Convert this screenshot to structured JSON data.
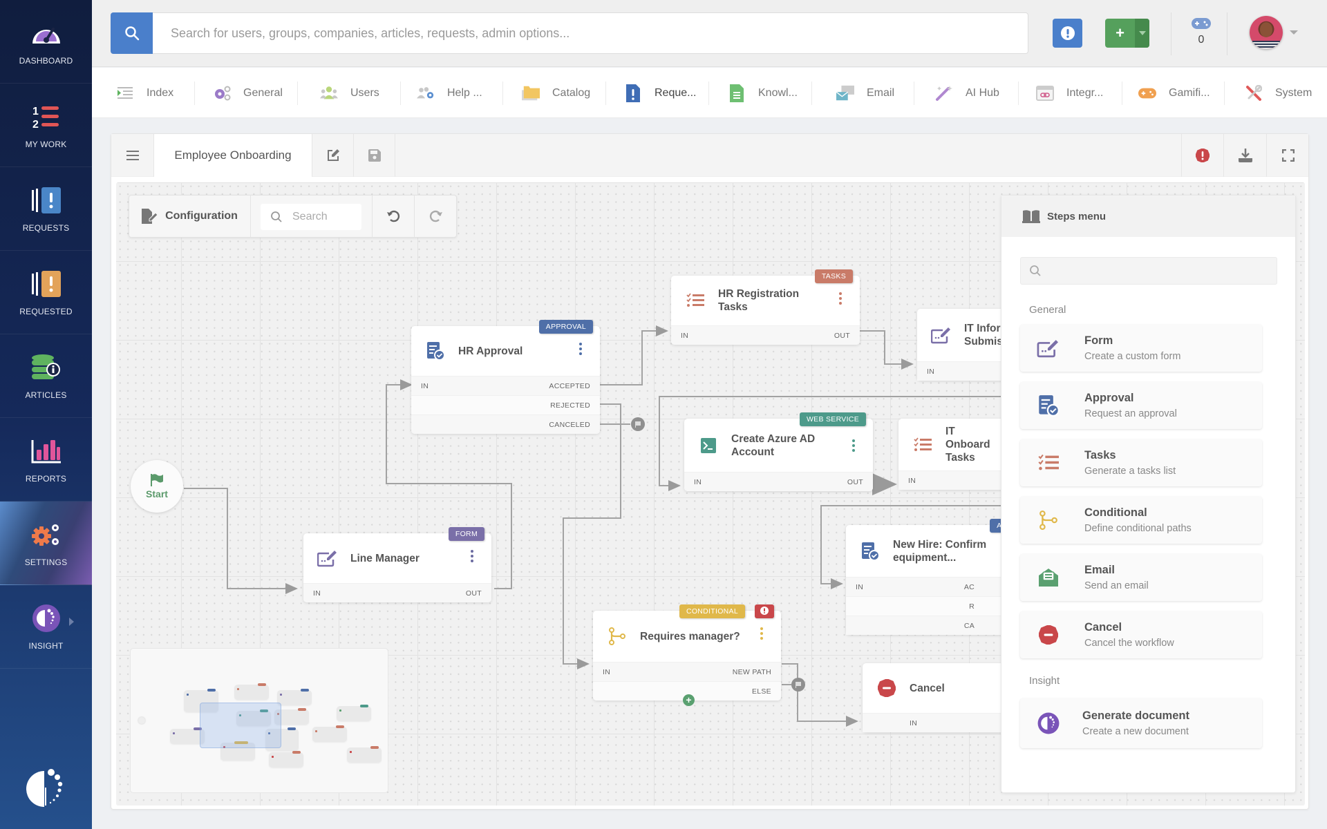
{
  "sidebar": {
    "items": [
      {
        "label": "DASHBOARD",
        "icon": "dashboard-gauge-icon"
      },
      {
        "label": "MY WORK",
        "icon": "numbered-list-icon"
      },
      {
        "label": "REQUESTS",
        "icon": "requests-icon"
      },
      {
        "label": "REQUESTED",
        "icon": "requested-icon"
      },
      {
        "label": "ARTICLES",
        "icon": "articles-database-icon"
      },
      {
        "label": "REPORTS",
        "icon": "bar-chart-icon"
      },
      {
        "label": "SETTINGS",
        "icon": "gears-icon",
        "active": true
      },
      {
        "label": "INSIGHT",
        "icon": "insight-icon"
      }
    ]
  },
  "topbar": {
    "search_placeholder": "Search for users, groups, companies, articles, requests, admin options...",
    "game_count": "0"
  },
  "nav_tabs": [
    {
      "label": "Index",
      "icon": "index-list-icon"
    },
    {
      "label": "General",
      "icon": "general-gears-icon"
    },
    {
      "label": "Users",
      "icon": "users-icon"
    },
    {
      "label": "Help ...",
      "icon": "helpdesk-icon"
    },
    {
      "label": "Catalog",
      "icon": "folder-icon"
    },
    {
      "label": "Reque...",
      "icon": "request-document-icon",
      "active": true
    },
    {
      "label": "Knowl...",
      "icon": "knowledge-document-icon"
    },
    {
      "label": "Email",
      "icon": "email-icon"
    },
    {
      "label": "AI Hub",
      "icon": "magic-wand-icon"
    },
    {
      "label": "Integr...",
      "icon": "integration-link-icon"
    },
    {
      "label": "Gamifi...",
      "icon": "gamepad-icon"
    },
    {
      "label": "System",
      "icon": "tools-icon"
    }
  ],
  "workflow": {
    "title": "Employee Onboarding",
    "toolbar": {
      "configuration_label": "Configuration",
      "search_placeholder": "Search"
    },
    "start_label": "Start",
    "nodes": {
      "hr_approval": {
        "title": "HR Approval",
        "badge": "APPROVAL",
        "ports": [
          "IN",
          "ACCEPTED",
          "REJECTED",
          "CANCELED"
        ]
      },
      "hr_registration": {
        "title": "HR Registration Tasks",
        "badge": "TASKS",
        "ports": [
          "IN",
          "OUT"
        ]
      },
      "it_info": {
        "title": "IT Information Submission",
        "title_visible": "IT Infor Submis",
        "ports": [
          "IN"
        ]
      },
      "azure_ad": {
        "title": "Create Azure AD Account",
        "badge": "WEB SERVICE",
        "ports": [
          "IN",
          "OUT"
        ]
      },
      "it_onboard": {
        "title": "IT Onboard Tasks",
        "ports": [
          "IN"
        ]
      },
      "line_manager": {
        "title": "Line Manager",
        "badge": "FORM",
        "ports": [
          "IN",
          "OUT"
        ]
      },
      "requires_manager": {
        "title": "Requires manager?",
        "badge": "CONDITIONAL",
        "ports": [
          "IN",
          "NEW PATH",
          "ELSE"
        ]
      },
      "new_hire": {
        "title": "New Hire: Confirm equipment...",
        "badge": "APP",
        "ports": [
          "IN",
          "AC",
          "R",
          "CA"
        ]
      },
      "cancel": {
        "title": "Cancel",
        "ports": [
          "IN"
        ]
      }
    }
  },
  "steps_menu": {
    "title": "Steps menu",
    "search_placeholder": "",
    "categories": [
      {
        "name": "General",
        "steps": [
          {
            "title": "Form",
            "desc": "Create a custom form"
          },
          {
            "title": "Approval",
            "desc": "Request an approval"
          },
          {
            "title": "Tasks",
            "desc": "Generate a tasks list"
          },
          {
            "title": "Conditional",
            "desc": "Define conditional paths"
          },
          {
            "title": "Email",
            "desc": "Send an email"
          },
          {
            "title": "Cancel",
            "desc": "Cancel the workflow"
          }
        ]
      },
      {
        "name": "Insight",
        "steps": [
          {
            "title": "Generate document",
            "desc": "Create a new document"
          }
        ]
      }
    ]
  },
  "colors": {
    "primary_blue": "#4a7fcb",
    "green": "#55a05c",
    "approval": "#4f6fa8",
    "tasks": "#c97b68",
    "form": "#7a6fa8",
    "web_service": "#4d9a8a",
    "conditional": "#e0b84a",
    "error": "#c9474a"
  }
}
